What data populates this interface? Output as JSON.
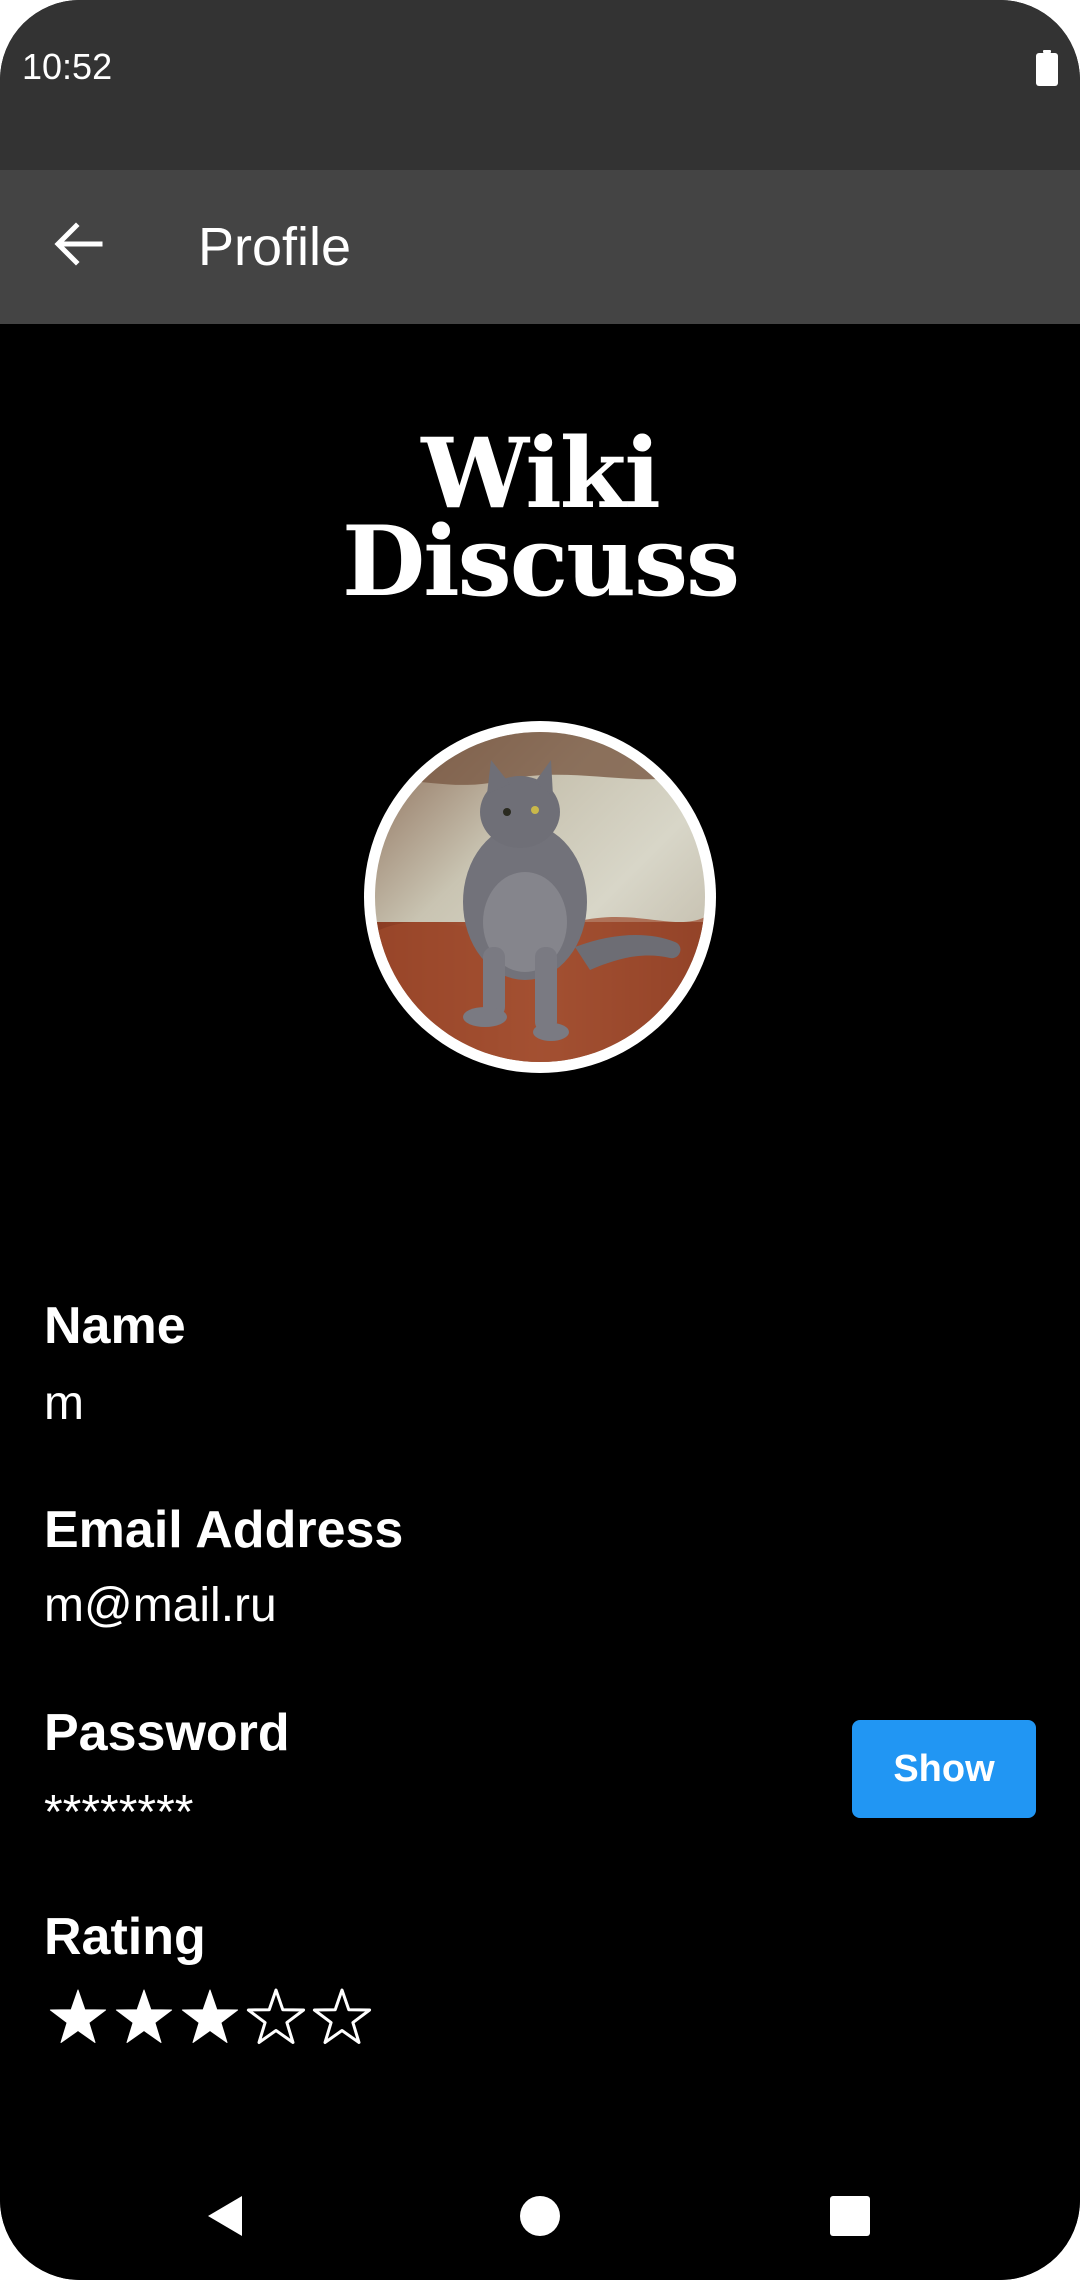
{
  "status_bar": {
    "time": "10:52",
    "battery_icon": "battery-full-icon"
  },
  "app_bar": {
    "back_icon": "arrow-back-icon",
    "title": "Profile"
  },
  "logo": {
    "line1": "Wiki",
    "line2": "Discuss"
  },
  "avatar": {
    "icon": "profile-photo-cat"
  },
  "profile": {
    "name_label": "Name",
    "name_value": "m",
    "email_label": "Email Address",
    "email_value": "m@mail.ru",
    "password_label": "Password",
    "password_value": "********",
    "show_button_label": "Show",
    "rating_label": "Rating",
    "rating": {
      "value": 3,
      "max": 5
    }
  },
  "nav_bar": {
    "back_icon": "nav-back-triangle-icon",
    "home_icon": "nav-home-circle-icon",
    "recents_icon": "nav-recents-square-icon"
  },
  "colors": {
    "status_bar": "#333333",
    "app_bar": "#444444",
    "background": "#000000",
    "text": "#ffffff",
    "accent": "#2196f3"
  }
}
